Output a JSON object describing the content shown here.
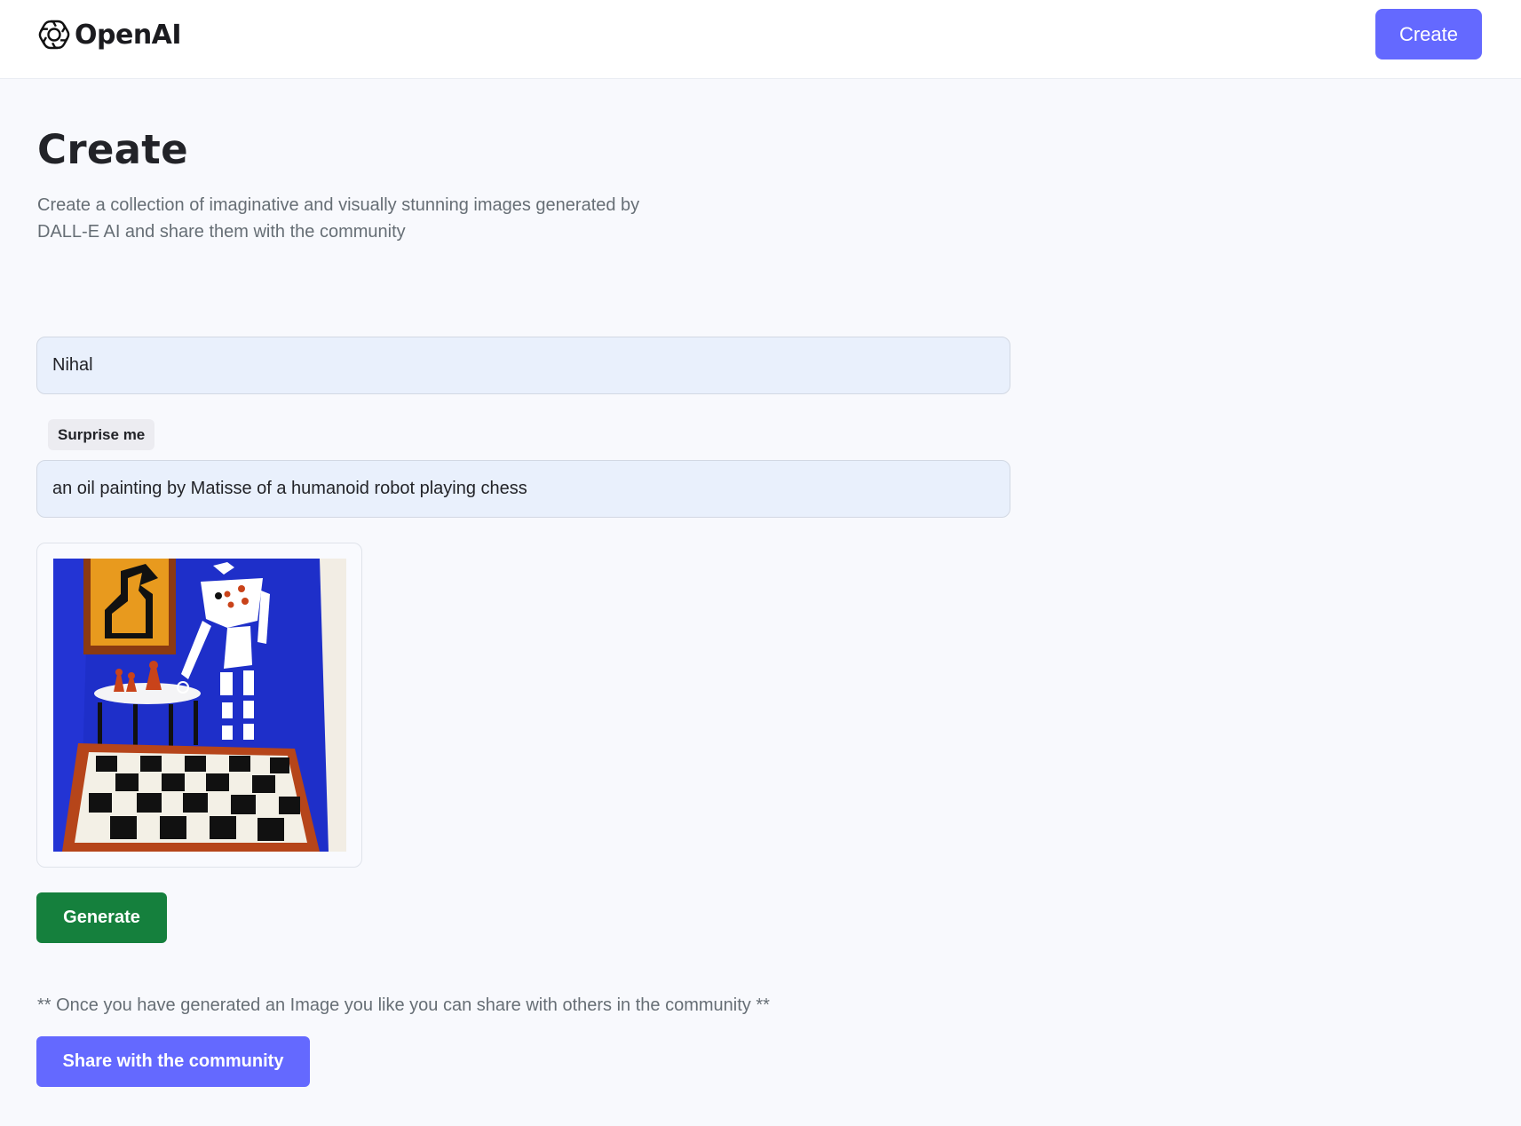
{
  "header": {
    "logo_text": "OpenAI",
    "logo_icon": "openai-logo-icon",
    "create_button_label": "Create"
  },
  "page": {
    "title": "Create",
    "subtitle": "Create a collection of imaginative and visually stunning images generated by DALL-E AI and share them with the community"
  },
  "form": {
    "name_value": "Nihal",
    "surprise_button_label": "Surprise me",
    "prompt_value": "an oil painting by Matisse of a humanoid robot playing chess"
  },
  "preview": {
    "image_subject": "an oil painting by Matisse of a humanoid robot playing chess"
  },
  "actions": {
    "generate_label": "Generate",
    "share_note": "** Once you have generated an Image you like you can share with others in the community **",
    "share_label": "Share with the community"
  },
  "colors": {
    "brand": "#6469ff",
    "generate": "#15803d",
    "background": "#f8f9fd",
    "input_bg": "#e9f0fc"
  }
}
